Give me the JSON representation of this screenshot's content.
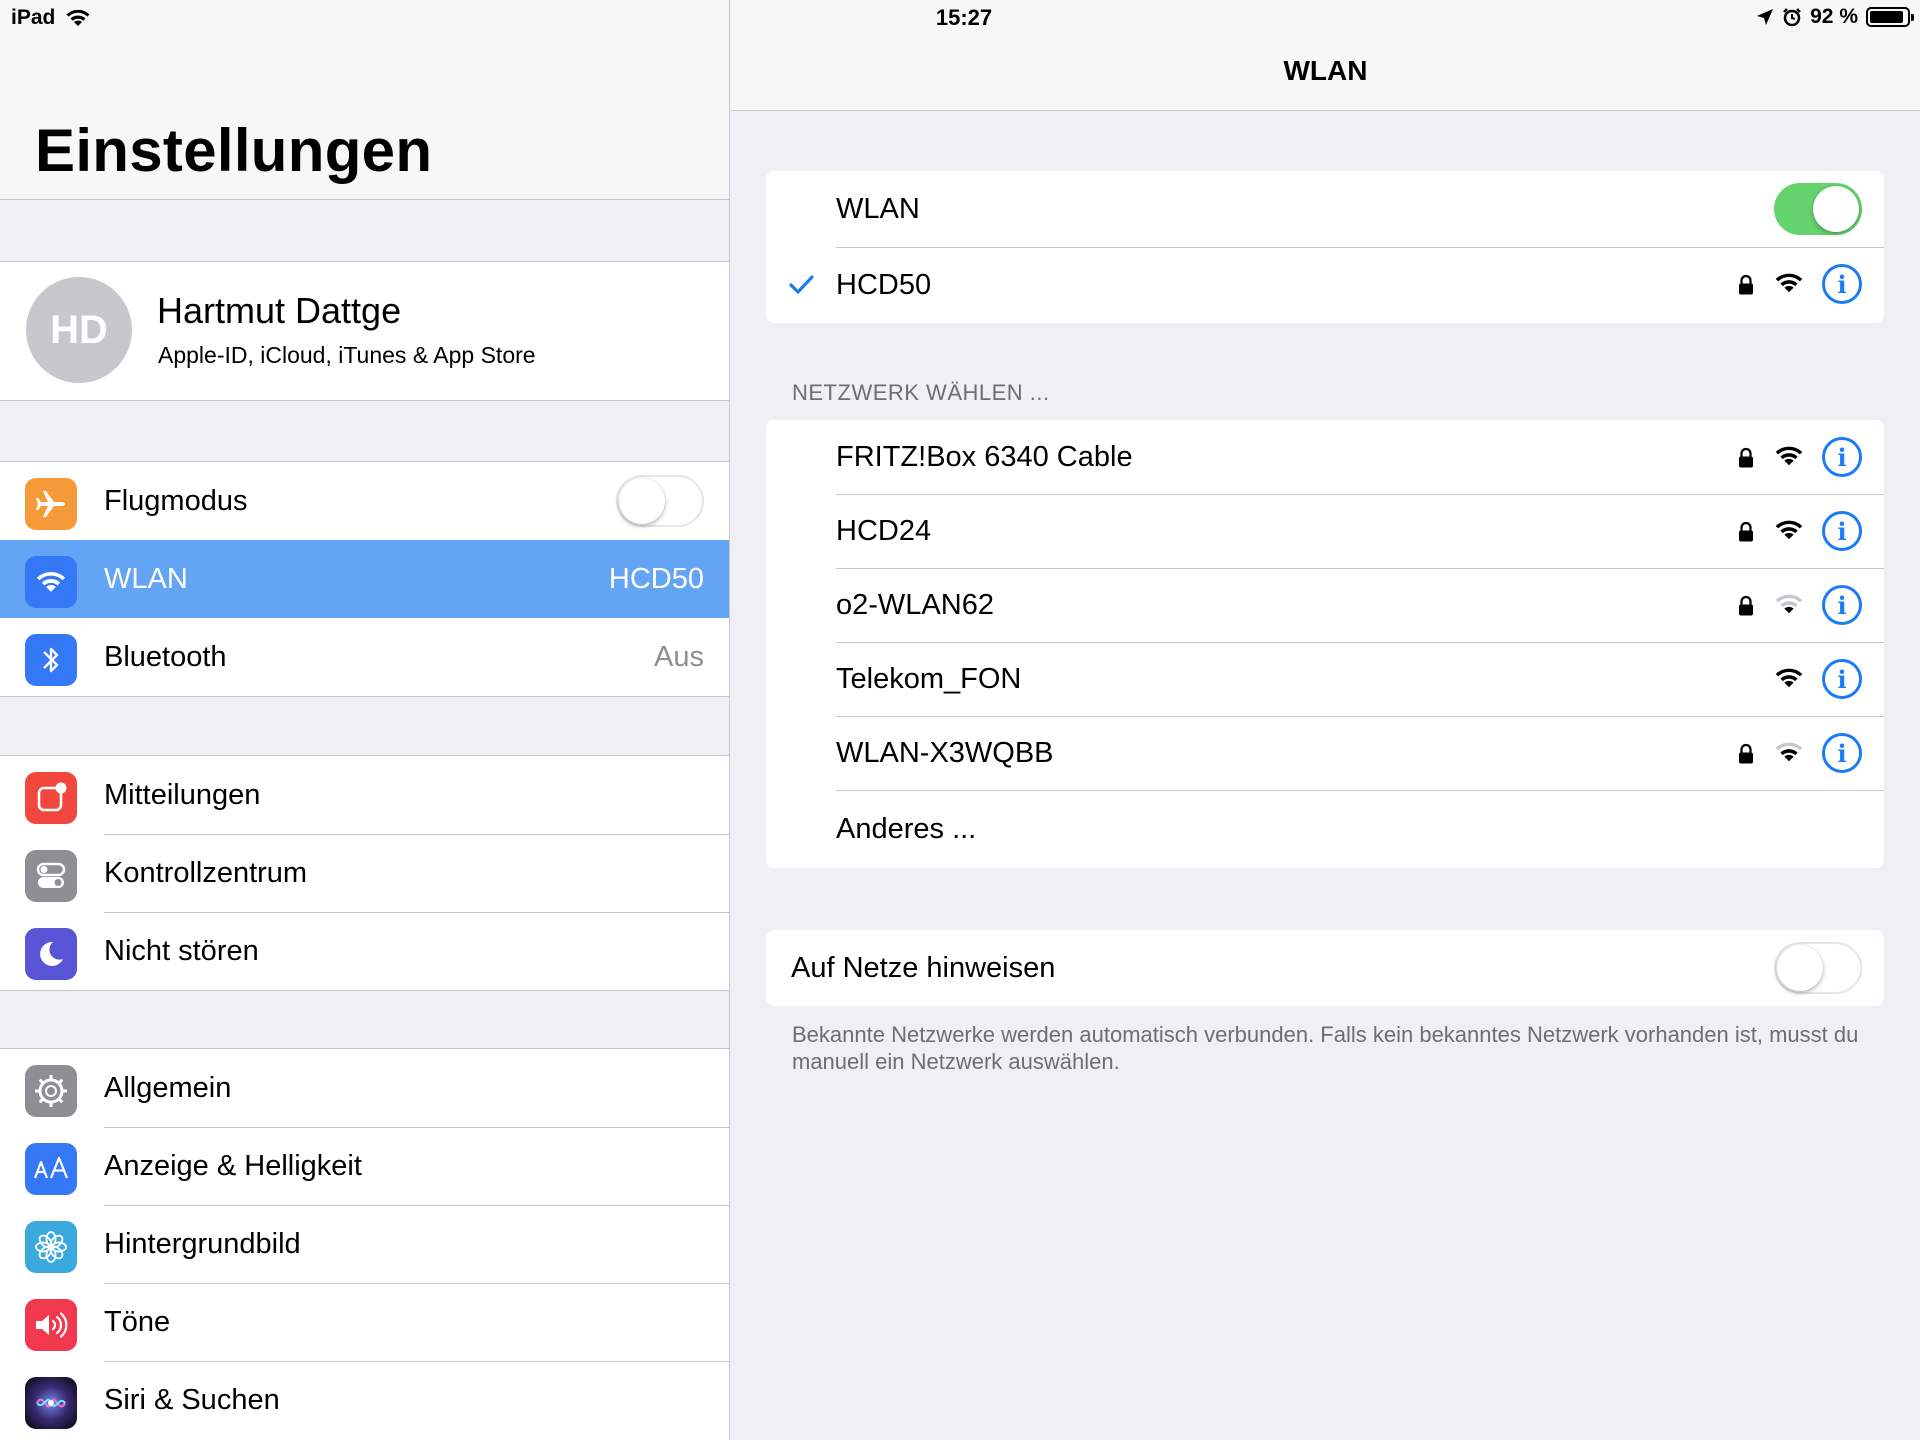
{
  "status_bar": {
    "device": "iPad",
    "time": "15:27",
    "battery_text": "92 %",
    "battery_level": 0.92
  },
  "master": {
    "title": "Einstellungen",
    "profile": {
      "initials": "HD",
      "name": "Hartmut Dattge",
      "subtitle": "Apple-ID, iCloud, iTunes & App Store"
    },
    "group1": [
      {
        "id": "flugmodus",
        "label": "Flugmodus",
        "icon": "airplane-icon",
        "icon_color": "#f49a38",
        "toggle": false
      },
      {
        "id": "wlan",
        "label": "WLAN",
        "icon": "wifi-icon",
        "icon_color": "#3478f6",
        "detail": "HCD50",
        "selected": true
      },
      {
        "id": "bluetooth",
        "label": "Bluetooth",
        "icon": "bluetooth-icon",
        "icon_color": "#3478f6",
        "detail": "Aus"
      }
    ],
    "group2": [
      {
        "id": "mitteilungen",
        "label": "Mitteilungen",
        "icon": "notifications-icon",
        "icon_color": "#f2473c"
      },
      {
        "id": "kontrollzentrum",
        "label": "Kontrollzentrum",
        "icon": "control-center-icon",
        "icon_color": "#8e8e93"
      },
      {
        "id": "nicht-stoeren",
        "label": "Nicht stören",
        "icon": "moon-icon",
        "icon_color": "#5a55d6"
      }
    ],
    "group3": [
      {
        "id": "allgemein",
        "label": "Allgemein",
        "icon": "gear-icon",
        "icon_color": "#8e8e93"
      },
      {
        "id": "anzeige",
        "label": "Anzeige & Helligkeit",
        "icon": "display-brightness-icon",
        "icon_color": "#3478f6"
      },
      {
        "id": "hintergrundbild",
        "label": "Hintergrundbild",
        "icon": "wallpaper-flower-icon",
        "icon_color": "#3aa9dd"
      },
      {
        "id": "toene",
        "label": "Töne",
        "icon": "speaker-icon",
        "icon_color": "#f0394f"
      },
      {
        "id": "siri",
        "label": "Siri & Suchen",
        "icon": "siri-icon",
        "icon_color": "#1c1c3a"
      }
    ]
  },
  "detail": {
    "nav_title": "WLAN",
    "wlan_label": "WLAN",
    "wlan_on": true,
    "connected_network": {
      "name": "HCD50",
      "secured": true,
      "signal": "strong"
    },
    "section_header": "NETZWERK WÄHLEN ...",
    "networks": [
      {
        "name": "FRITZ!Box 6340 Cable",
        "secured": true,
        "signal": "strong"
      },
      {
        "name": "HCD24",
        "secured": true,
        "signal": "strong"
      },
      {
        "name": "o2-WLAN62",
        "secured": true,
        "signal": "weak"
      },
      {
        "name": "Telekom_FON",
        "secured": false,
        "signal": "strong"
      },
      {
        "name": "WLAN-X3WQBB",
        "secured": true,
        "signal": "medium"
      }
    ],
    "other_label": "Anderes ...",
    "ask_join_label": "Auf Netze hinweisen",
    "ask_join_on": false,
    "footer": "Bekannte Netzwerke werden automatisch verbunden. Falls kein bekanntes Netzwerk vorhanden ist, musst du manuell ein Netzwerk auswählen.",
    "colors": {
      "accent": "#1a7cf5",
      "toggle_on": "#65d36e",
      "selection": "#64a4f5"
    }
  }
}
